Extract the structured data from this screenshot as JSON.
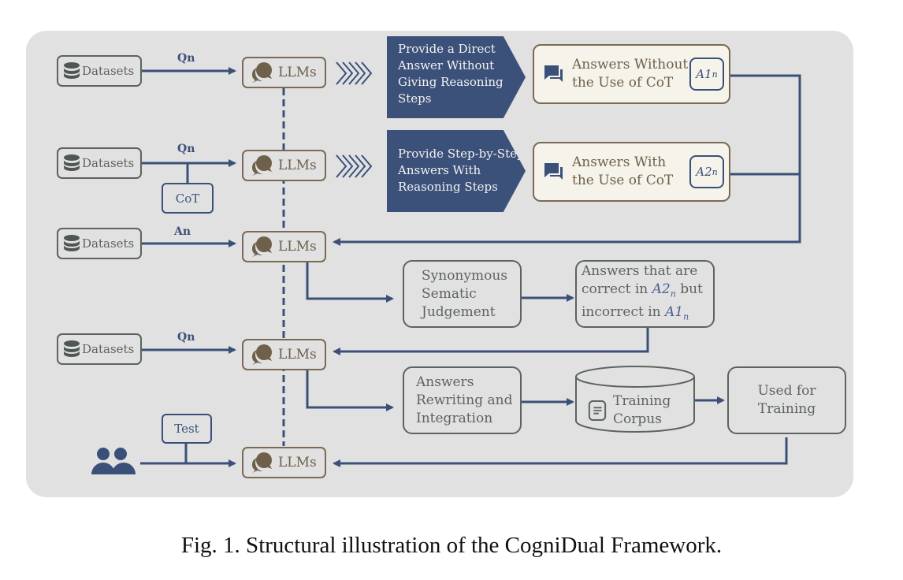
{
  "colors": {
    "panel_bg": "#e1e1e1",
    "navy": "#3b5079",
    "llm_brown": "#7a6a55",
    "dataset_gray": "#5c645f",
    "answer_fill": "#f5f3ea"
  },
  "inputs": [
    {
      "label": "Datasets",
      "icon": "database-icon",
      "edge_label": "Qn"
    },
    {
      "label": "Datasets",
      "icon": "database-icon",
      "edge_label": "Qn",
      "modifier": "CoT"
    },
    {
      "label": "Datasets",
      "icon": "database-icon",
      "edge_label": "An"
    },
    {
      "label": "Datasets",
      "icon": "database-icon",
      "edge_label": "Qn"
    },
    {
      "label": "",
      "icon": "users-icon",
      "modifier": "Test"
    }
  ],
  "llm_label": "LLMs",
  "llm_icon": "chat-bubbles-icon",
  "chevron_icon": "chevrons-right-icon",
  "modes": [
    {
      "text": "Provide a Direct Answer Without Giving Reasoning Steps"
    },
    {
      "text": "Provide Step-by-Step Answers With Reasoning Steps"
    }
  ],
  "answers": [
    {
      "text_line1": "Answers Without",
      "text_line2": "the Use of CoT",
      "tag_base": "A1",
      "tag_sub": "n",
      "icon": "messages-icon"
    },
    {
      "text_line1": "Answers With",
      "text_line2": "the Use of CoT",
      "tag_base": "A2",
      "tag_sub": "n",
      "icon": "messages-icon"
    }
  ],
  "judgement": {
    "line1": "Synonymous",
    "line2": "Sematic",
    "line3": "Judgement"
  },
  "filtered": {
    "line1": "Answers that are",
    "line2_pre": "correct in ",
    "line2_math": "A2",
    "line2_sub": "n",
    "line2_post": " but",
    "line3_pre": "incorrect in ",
    "line3_math": "A1",
    "line3_sub": "n"
  },
  "rewriting": {
    "line1": "Answers",
    "line2": "Rewriting and",
    "line3": "Integration"
  },
  "corpus": {
    "line1": "Training",
    "line2": "Corpus",
    "icon": "document-icon"
  },
  "training": {
    "line1": "Used for",
    "line2": "Training"
  },
  "caption": "Fig. 1.  Structural illustration of the CogniDual Framework."
}
